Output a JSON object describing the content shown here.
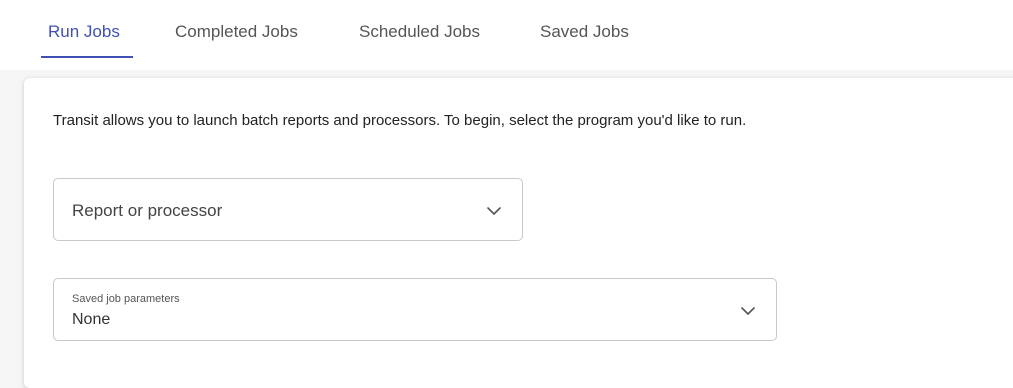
{
  "tabs": [
    {
      "label": "Run Jobs",
      "active": true
    },
    {
      "label": "Completed Jobs",
      "active": false
    },
    {
      "label": "Scheduled Jobs",
      "active": false
    },
    {
      "label": "Saved Jobs",
      "active": false
    }
  ],
  "main": {
    "intro_text": "Transit allows you to launch batch reports and processors. To begin, select the program you'd like to run.",
    "program_select": {
      "placeholder": "Report or processor",
      "icon": "chevron-down-icon"
    },
    "saved_params_select": {
      "label": "Saved job parameters",
      "value": "None",
      "icon": "chevron-down-icon"
    }
  },
  "colors": {
    "accent": "#3f51b5",
    "tab_text": "#555555",
    "background": "#f5f5f5",
    "card": "#ffffff",
    "border": "#c9c9c9"
  }
}
